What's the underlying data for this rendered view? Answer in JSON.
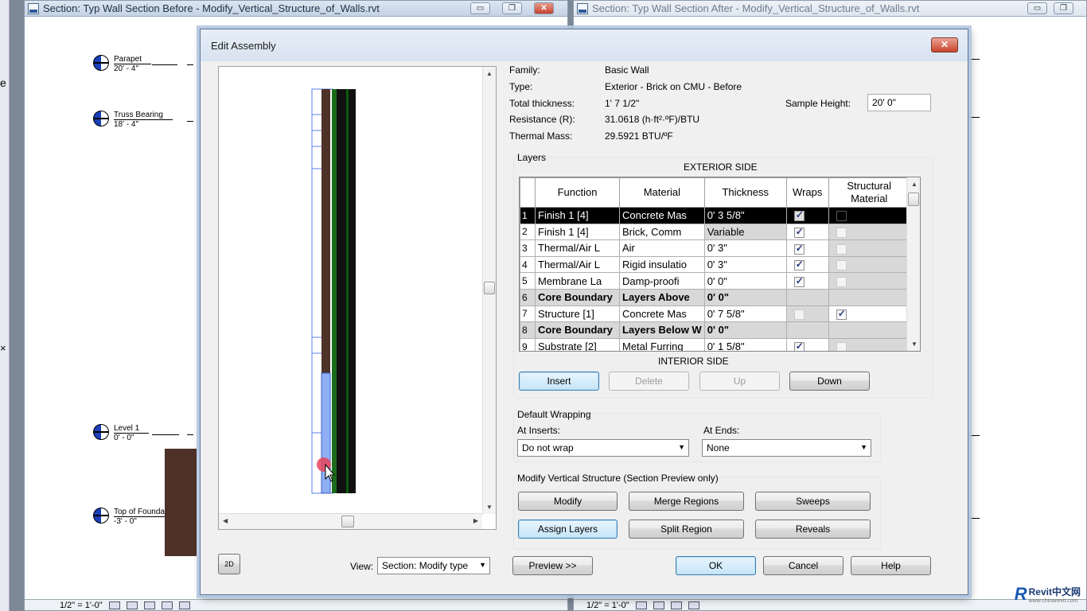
{
  "left_window": {
    "title": "Section: Typ Wall Section Before - Modify_Vertical_Structure_of_Walls.rvt",
    "levels": [
      {
        "name": "Parapet",
        "elev": "20' - 4\""
      },
      {
        "name": "Truss Bearing",
        "elev": "18' - 4\""
      },
      {
        "name": "Level 1",
        "elev": "0' - 0\""
      },
      {
        "name": "Top of Foundation",
        "elev": "-3' - 0\""
      }
    ],
    "scale": "1/2\" = 1'-0\""
  },
  "right_window": {
    "title": "Section: Typ Wall Section After - Modify_Vertical_Structure_of_Walls.rvt",
    "scale": "1/2\" = 1'-0\""
  },
  "left_edge_glyphs": {
    "letter": "e",
    "close": "×"
  },
  "window_buttons": {
    "minimize": "▭",
    "restore": "❐",
    "close": "✕"
  },
  "dialog": {
    "title": "Edit Assembly",
    "close_label": "✕",
    "info": {
      "family_label": "Family:",
      "family": "Basic Wall",
      "type_label": "Type:",
      "type": "Exterior - Brick on CMU - Before",
      "thickness_label": "Total thickness:",
      "thickness": "1'  7 1/2\"",
      "resistance_label": "Resistance (R):",
      "resistance": "31.0618 (h·ft²·ºF)/BTU",
      "mass_label": "Thermal Mass:",
      "mass": "29.5921 BTU/ºF",
      "sample_height_label": "Sample Height:",
      "sample_height": "20'  0\""
    },
    "layers": {
      "group_label": "Layers",
      "exterior_label": "EXTERIOR SIDE",
      "interior_label": "INTERIOR SIDE",
      "headers": [
        "Function",
        "Material",
        "Thickness",
        "Wraps",
        "Structural\nMaterial"
      ],
      "rows": [
        {
          "num": "1",
          "function": "Finish 1 [4]",
          "material": "Concrete Mas",
          "thickness": "0'  3 5/8\""
        },
        {
          "num": "2",
          "function": "Finish 1 [4]",
          "material": "Brick, Comm",
          "thickness": "Variable"
        },
        {
          "num": "3",
          "function": "Thermal/Air L",
          "material": "Air",
          "thickness": "0'  3\""
        },
        {
          "num": "4",
          "function": "Thermal/Air L",
          "material": "Rigid insulatio",
          "thickness": "0'  3\""
        },
        {
          "num": "5",
          "function": "Membrane La",
          "material": "Damp-proofi",
          "thickness": "0'  0\""
        },
        {
          "num": "6",
          "function": "Core Boundary",
          "material": "Layers Above",
          "thickness": "0'  0\""
        },
        {
          "num": "7",
          "function": "Structure [1]",
          "material": "Concrete Mas",
          "thickness": "0'  7 5/8\""
        },
        {
          "num": "8",
          "function": "Core Boundary",
          "material": "Layers Below W",
          "thickness": "0'  0\""
        },
        {
          "num": "9",
          "function": "Substrate [2]",
          "material": "Metal Furring",
          "thickness": "0'  1 5/8\""
        }
      ],
      "buttons": {
        "insert": "Insert",
        "delete": "Delete",
        "up": "Up",
        "down": "Down"
      }
    },
    "wrapping": {
      "group_label": "Default Wrapping",
      "inserts_label": "At Inserts:",
      "inserts_value": "Do not wrap",
      "ends_label": "At Ends:",
      "ends_value": "None"
    },
    "vertical": {
      "group_label": "Modify Vertical Structure (Section Preview only)",
      "modify": "Modify",
      "merge": "Merge Regions",
      "sweeps": "Sweeps",
      "assign": "Assign Layers",
      "split": "Split Region",
      "reveals": "Reveals"
    },
    "view_label": "View:",
    "view_value": "Section: Modify type",
    "preview_btn": "Preview >>",
    "ok": "OK",
    "cancel": "Cancel",
    "help": "Help",
    "preview_icon_label": "2D"
  },
  "watermark": {
    "brand": "Revit中文网",
    "url": "www.chinarevit.com"
  }
}
